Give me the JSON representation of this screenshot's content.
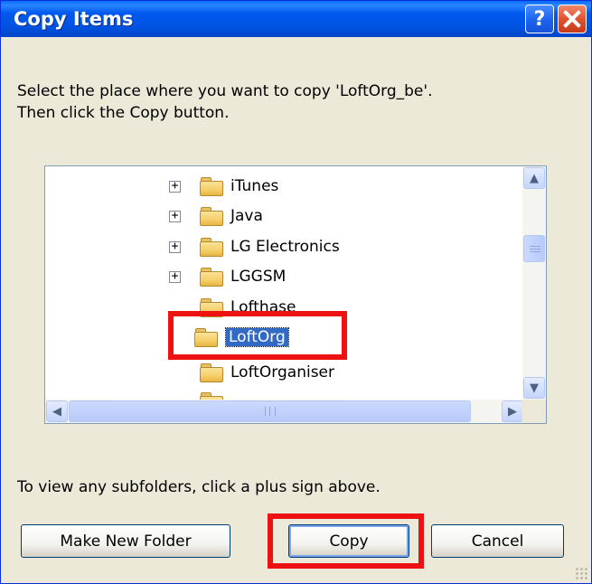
{
  "window": {
    "title": "Copy Items",
    "help_glyph": "?"
  },
  "instruction": {
    "line1": "Select the place where you want to copy 'LoftOrg_be'.",
    "line2": "Then click the Copy button."
  },
  "tree": {
    "items": [
      {
        "label": "iTunes",
        "expander": "+"
      },
      {
        "label": "Java",
        "expander": "+"
      },
      {
        "label": "LG Electronics",
        "expander": "+"
      },
      {
        "label": "LGGSM",
        "expander": "+"
      },
      {
        "label": "Lofthase",
        "expander": ""
      },
      {
        "label": "LoftOrg",
        "expander": "",
        "selected": true
      },
      {
        "label": "LoftOrganiser",
        "expander": ""
      }
    ],
    "vscroll": {
      "up_icon": "arrow-up-icon",
      "down_icon": "arrow-down-icon"
    },
    "hscroll": {
      "left_icon": "arrow-left-icon",
      "right_icon": "arrow-right-icon"
    }
  },
  "hint": "To view any subfolders, click a plus sign above.",
  "buttons": {
    "make_new_folder": "Make New Folder",
    "copy": "Copy",
    "cancel": "Cancel"
  },
  "colors": {
    "title_bar": "#0054e3",
    "selection": "#316ac5",
    "highlight_box": "#ee1111"
  }
}
